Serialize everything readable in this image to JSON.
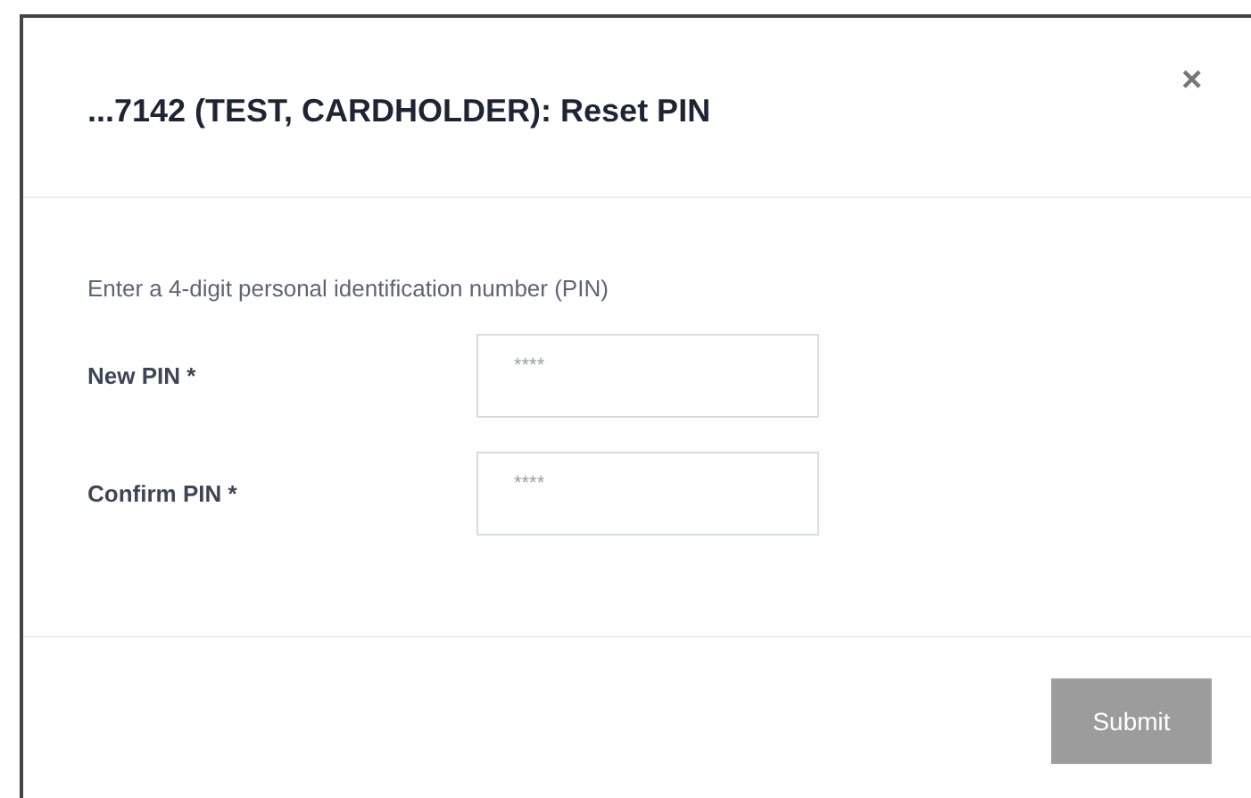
{
  "dialog": {
    "title": "...7142 (TEST, CARDHOLDER): Reset PIN",
    "close": "×"
  },
  "instructions": "Enter a 4-digit personal identification number (PIN)",
  "fields": [
    {
      "label": "New PIN *",
      "placeholder": "****"
    },
    {
      "label": "Confirm PIN *",
      "placeholder": "****"
    }
  ],
  "submit": {
    "label": "Submit",
    "disabled": true
  }
}
